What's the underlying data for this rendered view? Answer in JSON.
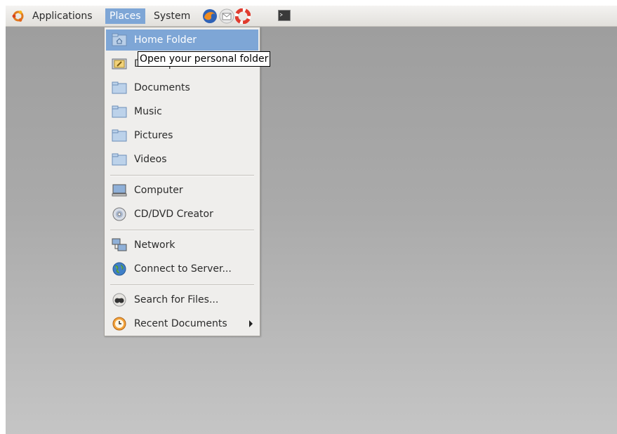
{
  "panel": {
    "applications_label": "Applications",
    "places_label": "Places",
    "system_label": "System",
    "launchers": [
      "firefox-icon",
      "mail-icon",
      "help-icon",
      "terminal-icon"
    ]
  },
  "places_menu": {
    "items": [
      {
        "label": "Home Folder",
        "icon": "home-folder-icon"
      },
      {
        "label": "Desktop",
        "icon": "desktop-icon"
      },
      {
        "label": "Documents",
        "icon": "folder-icon"
      },
      {
        "label": "Music",
        "icon": "folder-icon"
      },
      {
        "label": "Pictures",
        "icon": "folder-icon"
      },
      {
        "label": "Videos",
        "icon": "folder-icon"
      },
      {
        "label": "Computer",
        "icon": "computer-icon"
      },
      {
        "label": "CD/DVD Creator",
        "icon": "cd-icon"
      },
      {
        "label": "Network",
        "icon": "network-icon"
      },
      {
        "label": "Connect to Server...",
        "icon": "globe-icon"
      },
      {
        "label": "Search for Files...",
        "icon": "search-icon"
      },
      {
        "label": "Recent Documents",
        "icon": "recent-icon"
      }
    ]
  },
  "tooltip": {
    "text": "Open your personal folder"
  },
  "colors": {
    "highlight": "#7ea6d6",
    "menu_bg": "#efeeec"
  }
}
